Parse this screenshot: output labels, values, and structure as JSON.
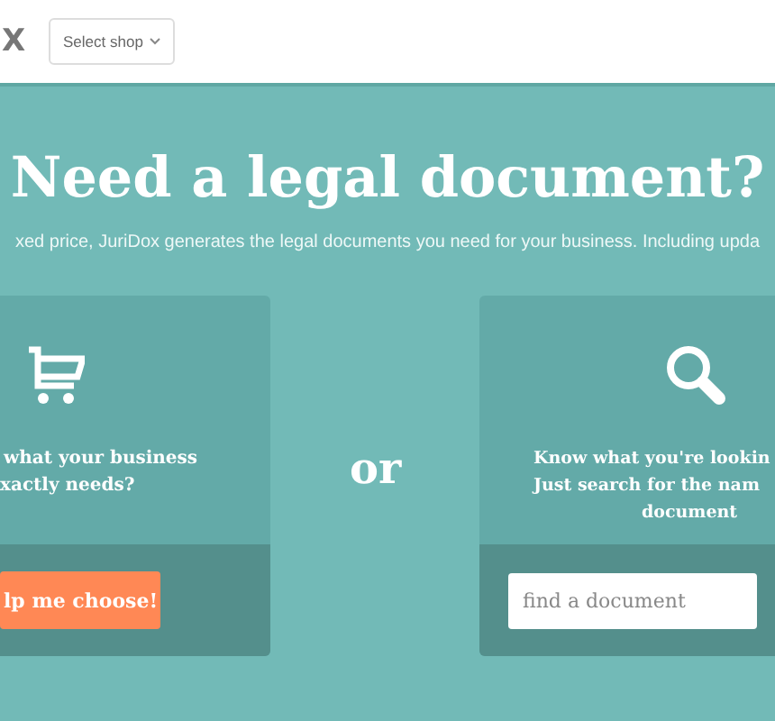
{
  "header": {
    "logo_tail": "X",
    "shop_select": {
      "label": "Select shop"
    }
  },
  "hero": {
    "title": "Need a legal document?",
    "subtitle": "xed price, JuriDox generates the legal documents you need for your business. Including upda"
  },
  "choose_card": {
    "lines": [
      "what your business",
      "xactly needs?"
    ],
    "button": "lp me choose!"
  },
  "separator": "or",
  "search_card": {
    "lines": [
      "Know what you're lookin",
      "Just search for the nam",
      "document"
    ],
    "search": {
      "placeholder": "find a document"
    }
  }
}
